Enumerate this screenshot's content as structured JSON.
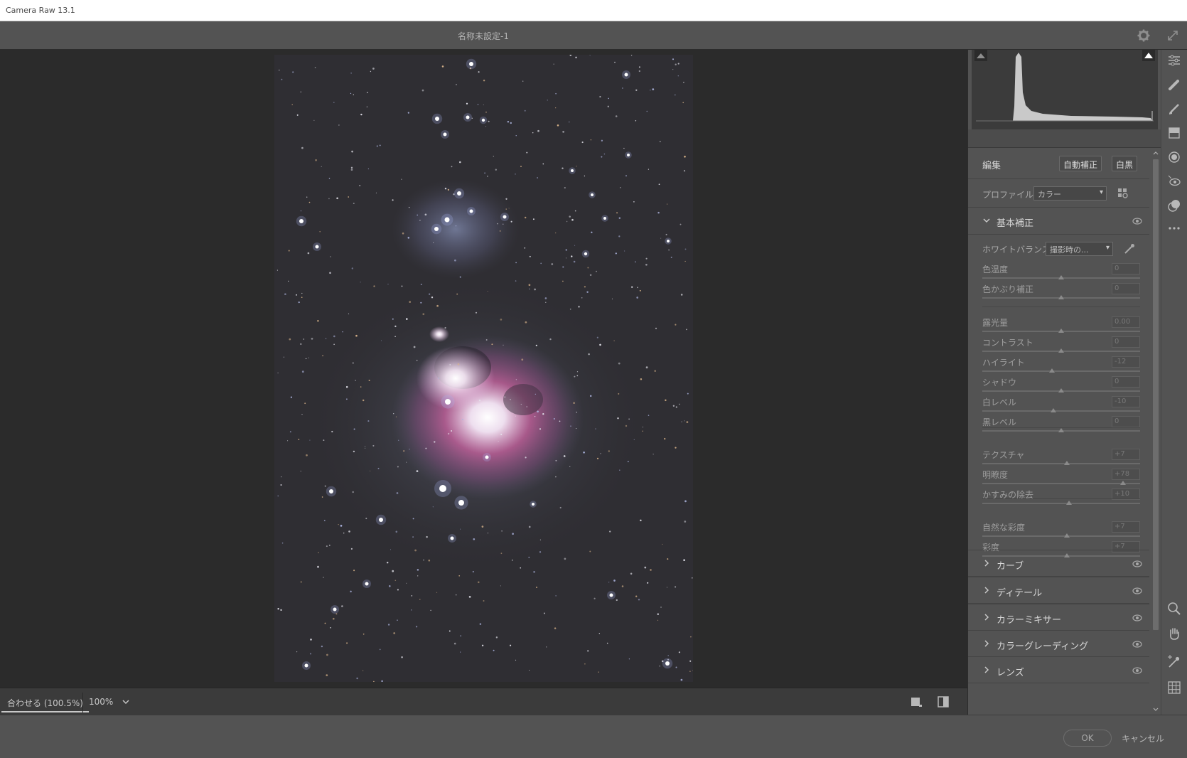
{
  "window": {
    "title": "Camera Raw 13.1"
  },
  "header": {
    "doc_title": "名称未設定-1"
  },
  "canvas_bar": {
    "zoom_fit": "合わせる (100.5%)",
    "zoom_value": "100%"
  },
  "panel": {
    "edit_title": "編集",
    "auto_button": "自動補正",
    "bw_button": "白黒",
    "profile_label": "プロファイル",
    "profile_value": "カラー",
    "basic": {
      "title": "基本補正",
      "wb_label": "ホワイトバランス",
      "wb_value": "撮影時の...",
      "sliders": [
        {
          "name": "色温度",
          "value": "0",
          "level": 0.5
        },
        {
          "name": "色かぶり補正",
          "value": "0",
          "level": 0.5
        },
        {
          "name": "露光量",
          "value": "0.00",
          "level": 0.5
        },
        {
          "name": "コントラスト",
          "value": "0",
          "level": 0.5
        },
        {
          "name": "ハイライト",
          "value": "-12",
          "level": 0.44
        },
        {
          "name": "シャドウ",
          "value": "0",
          "level": 0.5
        },
        {
          "name": "白レベル",
          "value": "-10",
          "level": 0.45
        },
        {
          "name": "黒レベル",
          "value": "0",
          "level": 0.5
        },
        {
          "name": "テクスチャ",
          "value": "+7",
          "level": 0.535
        },
        {
          "name": "明瞭度",
          "value": "+78",
          "level": 0.89
        },
        {
          "name": "かすみの除去",
          "value": "+10",
          "level": 0.55
        },
        {
          "name": "自然な彩度",
          "value": "+7",
          "level": 0.535
        },
        {
          "name": "彩度",
          "value": "+7",
          "level": 0.535
        }
      ]
    },
    "sections": [
      {
        "title": "カーブ"
      },
      {
        "title": "ディテール"
      },
      {
        "title": "カラーミキサー"
      },
      {
        "title": "カラーグレーディング"
      },
      {
        "title": "レンズ"
      }
    ]
  },
  "footer": {
    "ok": "OK",
    "cancel": "キャンセル"
  }
}
